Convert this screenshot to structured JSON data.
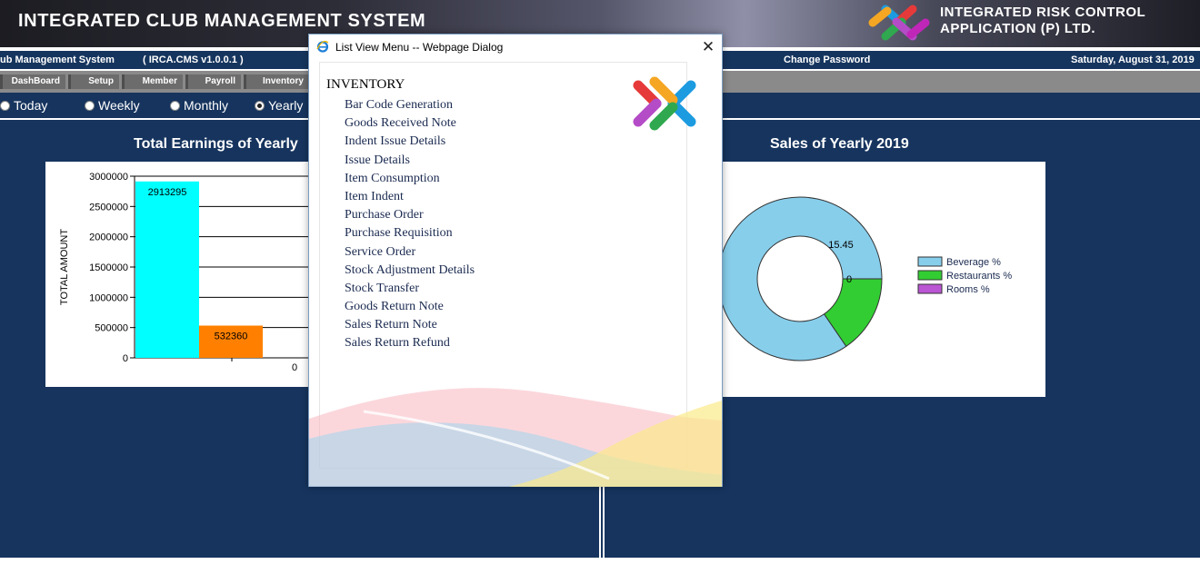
{
  "header": {
    "title": "INTEGRATED CLUB MANAGEMENT SYSTEM",
    "company_line1": "INTEGRATED RISK CONTROL",
    "company_line2": "APPLICATION (P) LTD."
  },
  "infobar": {
    "app_name": "ub Management System",
    "version": "( IRCA.CMS v1.0.0.1 )",
    "change_password": "Change Password",
    "date": "Saturday, August 31, 2019"
  },
  "menu": [
    "DashBoard",
    "Setup",
    "Member",
    "Payroll",
    "Inventory"
  ],
  "period": {
    "options": [
      "Today",
      "Weekly",
      "Monthly",
      "Yearly"
    ],
    "selected": "Yearly"
  },
  "earnings": {
    "title": "Total Earnings of Yearly"
  },
  "sales": {
    "title": "Sales of Yearly 2019"
  },
  "chart_data": [
    {
      "type": "bar",
      "title": "Total Earnings of Yearly",
      "ylabel": "TOTAL AMOUNT",
      "ylim": [
        0,
        3000000
      ],
      "yticks": [
        "3000000",
        "2500000",
        "2000000",
        "1500000",
        "1000000",
        "500000",
        "0"
      ],
      "values": [
        2913295,
        532360,
        0
      ],
      "value_labels": [
        "2913295",
        "532360",
        "0"
      ],
      "colors": [
        "#00ffff",
        "#ff8000",
        "#cccccc"
      ]
    },
    {
      "type": "pie",
      "title": "Sales of Yearly 2019",
      "style": "doughnut",
      "legend_position": "right",
      "slices": [
        {
          "name": "Beverage %",
          "value": 84.55,
          "color": "#87ceeb"
        },
        {
          "name": "Restaurants %",
          "value": 15.45,
          "color": "#32cd32"
        },
        {
          "name": "Rooms %",
          "value": 0,
          "color": "#ba55d3"
        }
      ],
      "visible_labels": [
        "15.45",
        "0"
      ]
    }
  ],
  "dialog": {
    "title": "List View Menu -- Webpage Dialog",
    "close": "✕",
    "heading": "INVENTORY",
    "items": [
      "Bar Code Generation",
      "Goods Received Note",
      "Indent Issue Details",
      "Issue Details",
      "Item Consumption",
      "Item Indent",
      "Purchase Order",
      "Purchase Requisition",
      "Service Order",
      "Stock Adjustment Details",
      "Stock Transfer",
      "Goods Return Note",
      "Sales Return Note",
      "Sales Return Refund"
    ]
  }
}
